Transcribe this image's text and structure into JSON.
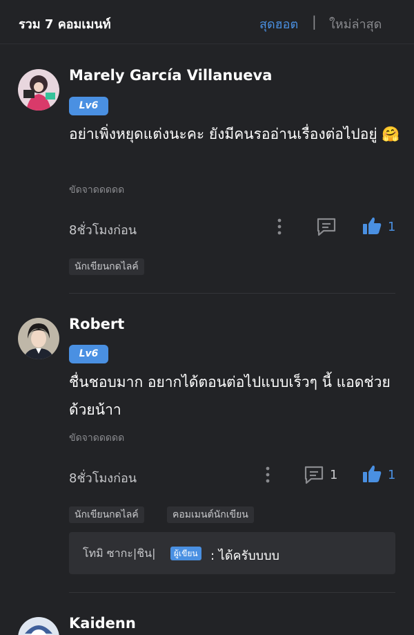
{
  "header": {
    "count_label": "รวม 7 คอมเมนท์",
    "sort_hot": "สุดฮอต",
    "divider": "|",
    "sort_new": "ใหม่ล่าสุด"
  },
  "comments": [
    {
      "username": "Marely García Villanueva",
      "level": "Lv6",
      "text": "อย่าเพิ่งหยุดแต่งนะคะ ยังมีคนรออ่านเรื่องต่อไปอยู่ 🤗",
      "sub": "ขัดจาดดดดด",
      "time": "8ชั่วโมงก่อน",
      "likes": "1",
      "tags": [
        "นักเขียนกดไลค์"
      ]
    },
    {
      "username": "Robert",
      "level": "Lv6",
      "text": "ชื่นชอบมาก อยากได้ตอนต่อไปแบบเร็วๆ นี้ แอดช่วยด้วยน้าา",
      "sub": "ขัดจาดดดดด",
      "time": "8ชั่วโมงก่อน",
      "replies": "1",
      "likes": "1",
      "tags": [
        "นักเขียนกดไลค์",
        "คอมเมนต์นักเขียน"
      ],
      "reply": {
        "author": "โทมิ ซากะ|ชิน|",
        "badge": "ผู้เขียน",
        "text": ": ได้ครับบบบ"
      }
    },
    {
      "username": "Kaidenn"
    }
  ],
  "colors": {
    "background": "#222326",
    "accent": "#4a90e2",
    "muted": "#8a8b8f"
  },
  "icons": [
    "more-vertical-icon",
    "comment-icon",
    "thumbs-up-icon"
  ]
}
